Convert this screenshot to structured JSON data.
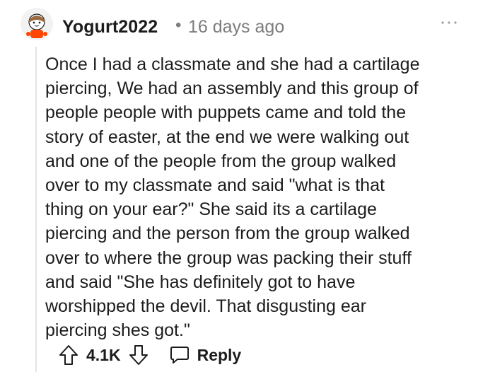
{
  "comment": {
    "username": "Yogurt2022",
    "separator": "•",
    "timestamp": "16 days ago",
    "avatar_icon": "snoo-avatar-icon",
    "more_icon": "more-options-icon",
    "body": "Once I had a classmate and she had a cartilage\npiercing, We had an assembly and this group of\npeople people with puppets came and told the\nstory of easter, at the end we were walking out\nand one of the people from the group walked\nover to my classmate and said \"what is that\nthing on your ear?\" She said its a cartilage\npiercing and the person from the group walked\nover to where the group was packing their stuff\nand said \"She has definitely got to have\nworshipped the devil. That disgusting ear\npiercing shes got.\""
  },
  "actions": {
    "upvote_icon": "arrow-up-icon",
    "score": "4.1K",
    "downvote_icon": "arrow-down-icon",
    "reply_icon": "speech-bubble-icon",
    "reply_label": "Reply"
  },
  "colors": {
    "text": "#1c1c1c",
    "muted": "#7c7c7c",
    "thread_line": "#e4e4e4",
    "avatar_accent": "#ff4500"
  }
}
